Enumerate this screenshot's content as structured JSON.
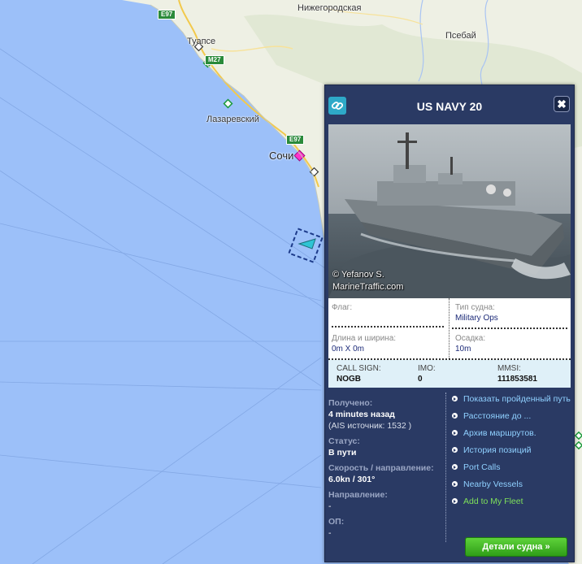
{
  "map": {
    "towns": [
      {
        "name": "Нижегородская"
      },
      {
        "name": "Туапсе"
      },
      {
        "name": "Псебай"
      },
      {
        "name": "Лазаревский"
      },
      {
        "name": "Сочи"
      }
    ],
    "roads": [
      "E97",
      "M27",
      "E97"
    ]
  },
  "popup": {
    "title": "US NAVY 20",
    "photo_credit_line1": "© Yefanov S.",
    "photo_credit_line2": "MarineTraffic.com",
    "flag": {
      "label": "Флаг:",
      "value": ""
    },
    "vessel_type": {
      "label": "Тип судна:",
      "value": "Military Ops"
    },
    "size": {
      "label": "Длина и ширина:",
      "value": "0m X 0m"
    },
    "draught": {
      "label": "Осадка:",
      "value": "10m"
    },
    "call_sign": {
      "label": "CALL SIGN:",
      "value": "NOGB"
    },
    "imo": {
      "label": "IMO:",
      "value": "0"
    },
    "mmsi": {
      "label": "MMSI:",
      "value": "111853581"
    },
    "received": {
      "label": "Получено:",
      "value": "4 minutes назад",
      "source": "(AIS источник: 1532 )"
    },
    "status": {
      "label": "Статус:",
      "value": "В пути"
    },
    "speed": {
      "label": "Скорость / направление:",
      "value": "6.0kn / 301°"
    },
    "heading": {
      "label": "Направление:",
      "value": "-"
    },
    "op": {
      "label": "ОП:",
      "value": "-"
    },
    "links": [
      {
        "label": "Показать пройденный путь"
      },
      {
        "label": "Расстояние до ..."
      },
      {
        "label": "Архив маршрутов."
      },
      {
        "label": "История позиций"
      },
      {
        "label": "Port Calls"
      },
      {
        "label": "Nearby Vessels"
      },
      {
        "label": "Add to My Fleet"
      }
    ],
    "details_button": "Детали судна »"
  },
  "colors": {
    "sea": "#9cc0f9",
    "land": "#eef0e4",
    "popup_bg": "#2a3a64",
    "link": "#8fd0ff",
    "fleet_link": "#7ee05a",
    "button_green": "#3fb521",
    "vessel_marker": "#2ec4d4",
    "port_marker": "#ff33cc"
  }
}
